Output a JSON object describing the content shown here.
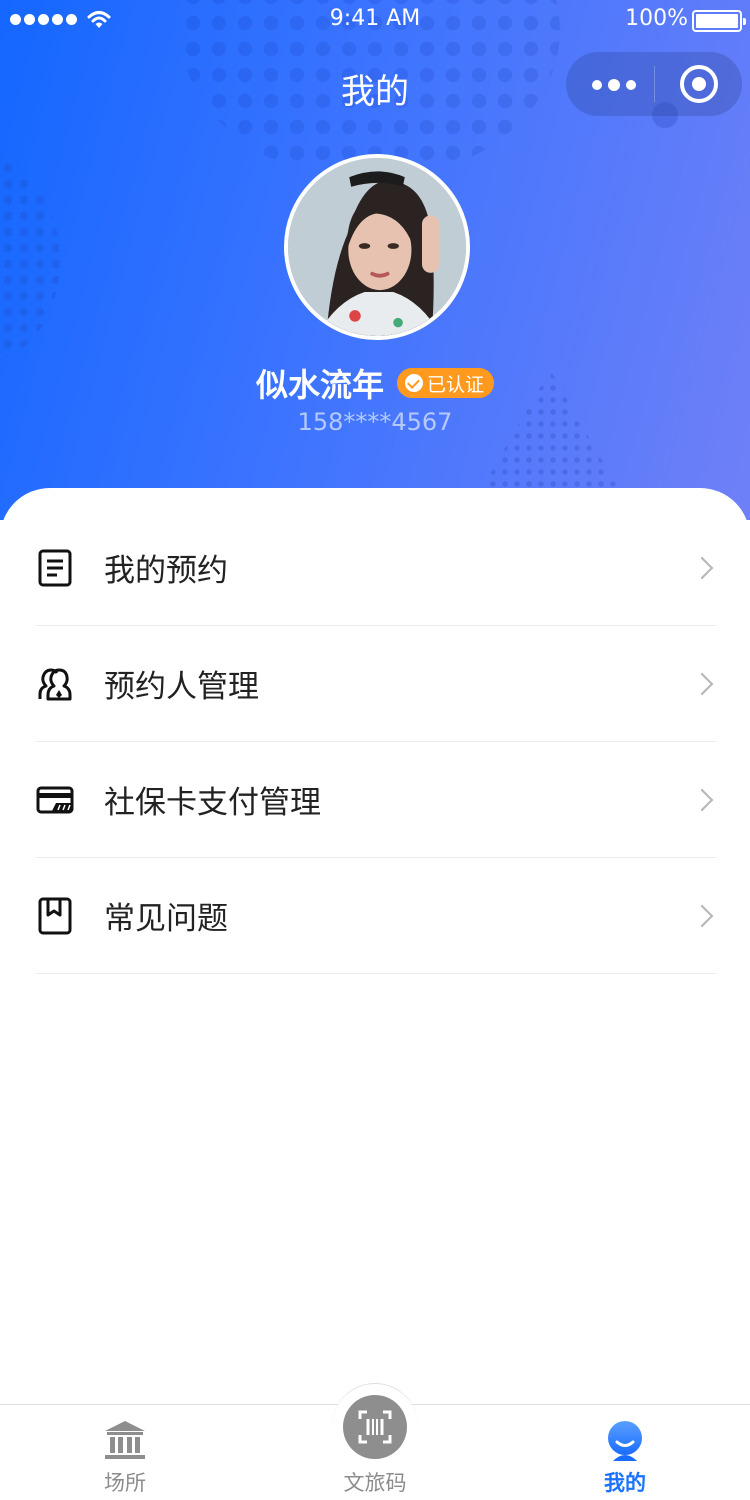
{
  "status_bar": {
    "time": "9:41 AM",
    "battery": "100%"
  },
  "header": {
    "title": "我的"
  },
  "profile": {
    "name": "似水流年",
    "badge": "已认证",
    "phone": "158****4567"
  },
  "menu": [
    {
      "label": "我的预约",
      "icon": "document-icon"
    },
    {
      "label": "预约人管理",
      "icon": "contacts-icon"
    },
    {
      "label": "社保卡支付管理",
      "icon": "card-icon"
    },
    {
      "label": "常见问题",
      "icon": "bookmark-icon"
    }
  ],
  "tabbar": [
    {
      "label": "场所",
      "icon": "museum-icon",
      "active": false
    },
    {
      "label": "文旅码",
      "icon": "scan-icon",
      "active": false
    },
    {
      "label": "我的",
      "icon": "user-icon",
      "active": true
    }
  ],
  "colors": {
    "accent": "#1a73ff",
    "badge": "#ff9a1e",
    "header_start": "#1467ff",
    "header_end": "#6f80f7"
  }
}
